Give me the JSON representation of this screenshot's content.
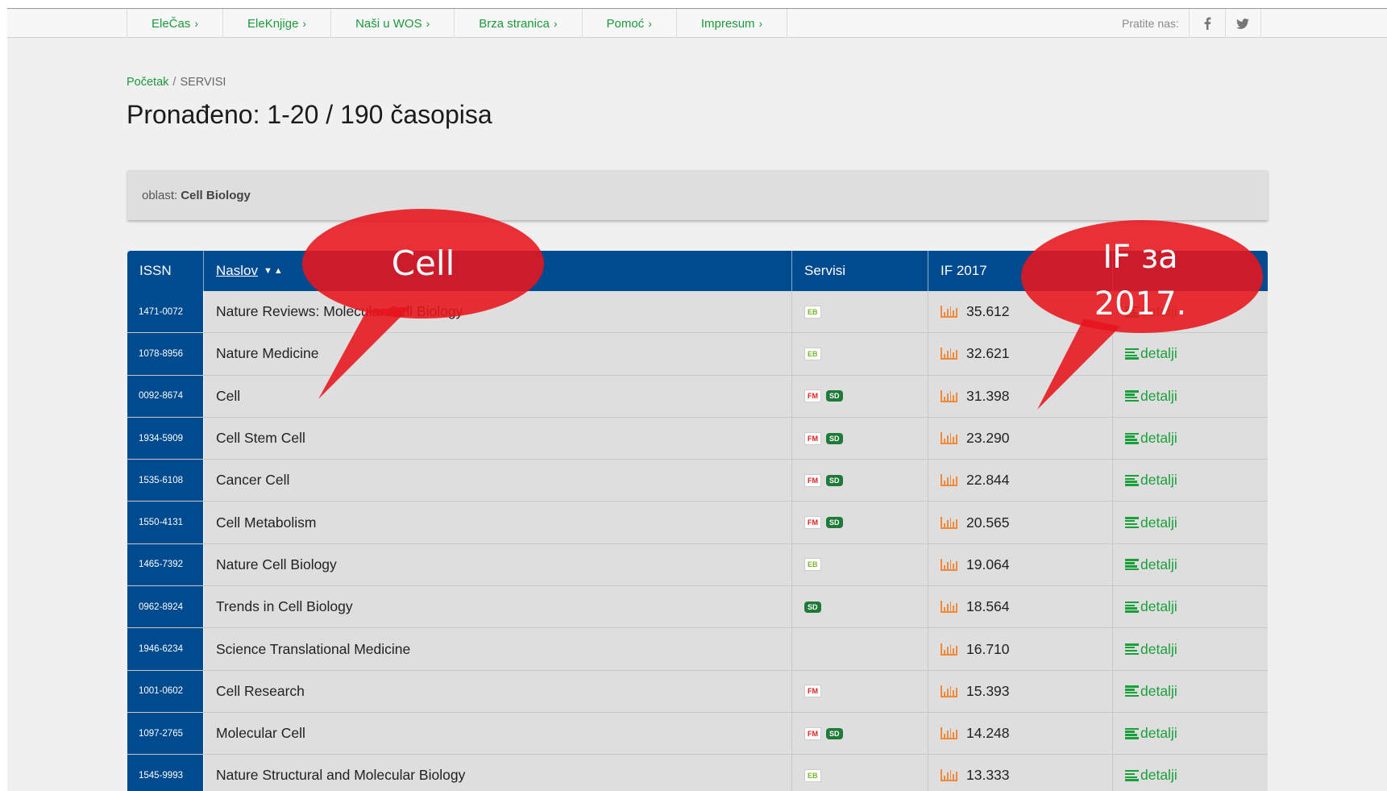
{
  "nav": {
    "items": [
      "EleČas",
      "EleKnjige",
      "Naši u WOS",
      "Brza stranica",
      "Pomoć",
      "Impresum"
    ],
    "chevron": "›",
    "follow_label": "Pratite nas:",
    "social": [
      "facebook-icon",
      "twitter-icon"
    ]
  },
  "breadcrumb": {
    "home": "Početak",
    "separator": "/",
    "current": "SERVISI"
  },
  "page_title": "Pronađeno: 1-20 / 190 časopisa",
  "filter": {
    "label": "oblast:",
    "value": "Cell Biology"
  },
  "table": {
    "headers": {
      "issn": "ISSN",
      "title": "Naslov",
      "services": "Servisi",
      "if": "IF 2017"
    },
    "rows": [
      {
        "issn": "1471-0072",
        "title": "Nature Reviews: Molecular Cell Biology",
        "services": [
          "EB"
        ],
        "if": "35.612",
        "details": "detalji"
      },
      {
        "issn": "1078-8956",
        "title": "Nature Medicine",
        "services": [
          "EB"
        ],
        "if": "32.621",
        "details": "detalji"
      },
      {
        "issn": "0092-8674",
        "title": "Cell",
        "services": [
          "FM",
          "SD"
        ],
        "if": "31.398",
        "details": "detalji"
      },
      {
        "issn": "1934-5909",
        "title": "Cell Stem Cell",
        "services": [
          "FM",
          "SD"
        ],
        "if": "23.290",
        "details": "detalji"
      },
      {
        "issn": "1535-6108",
        "title": "Cancer Cell",
        "services": [
          "FM",
          "SD"
        ],
        "if": "22.844",
        "details": "detalji"
      },
      {
        "issn": "1550-4131",
        "title": "Cell Metabolism",
        "services": [
          "FM",
          "SD"
        ],
        "if": "20.565",
        "details": "detalji"
      },
      {
        "issn": "1465-7392",
        "title": "Nature Cell Biology",
        "services": [
          "EB"
        ],
        "if": "19.064",
        "details": "detalji"
      },
      {
        "issn": "0962-8924",
        "title": "Trends in Cell Biology",
        "services": [
          "SD"
        ],
        "if": "18.564",
        "details": "detalji"
      },
      {
        "issn": "1946-6234",
        "title": "Science Translational Medicine",
        "services": [],
        "if": "16.710",
        "details": "detalji"
      },
      {
        "issn": "1001-0602",
        "title": "Cell Research",
        "services": [
          "FM"
        ],
        "if": "15.393",
        "details": "detalji"
      },
      {
        "issn": "1097-2765",
        "title": "Molecular Cell",
        "services": [
          "FM",
          "SD"
        ],
        "if": "14.248",
        "details": "detalji"
      },
      {
        "issn": "1545-9993",
        "title": "Nature Structural and Molecular Biology",
        "services": [
          "EB"
        ],
        "if": "13.333",
        "details": "detalji"
      }
    ]
  },
  "annotations": {
    "cell_bubble": "Cell",
    "if_bubble_line1": "IF за",
    "if_bubble_line2": "2017.",
    "bubble_color": "#e8141c"
  },
  "colors": {
    "accent_green": "#1a9a3a",
    "header_blue": "#004a8f",
    "chart_icon_orange": "#f08a3a"
  }
}
